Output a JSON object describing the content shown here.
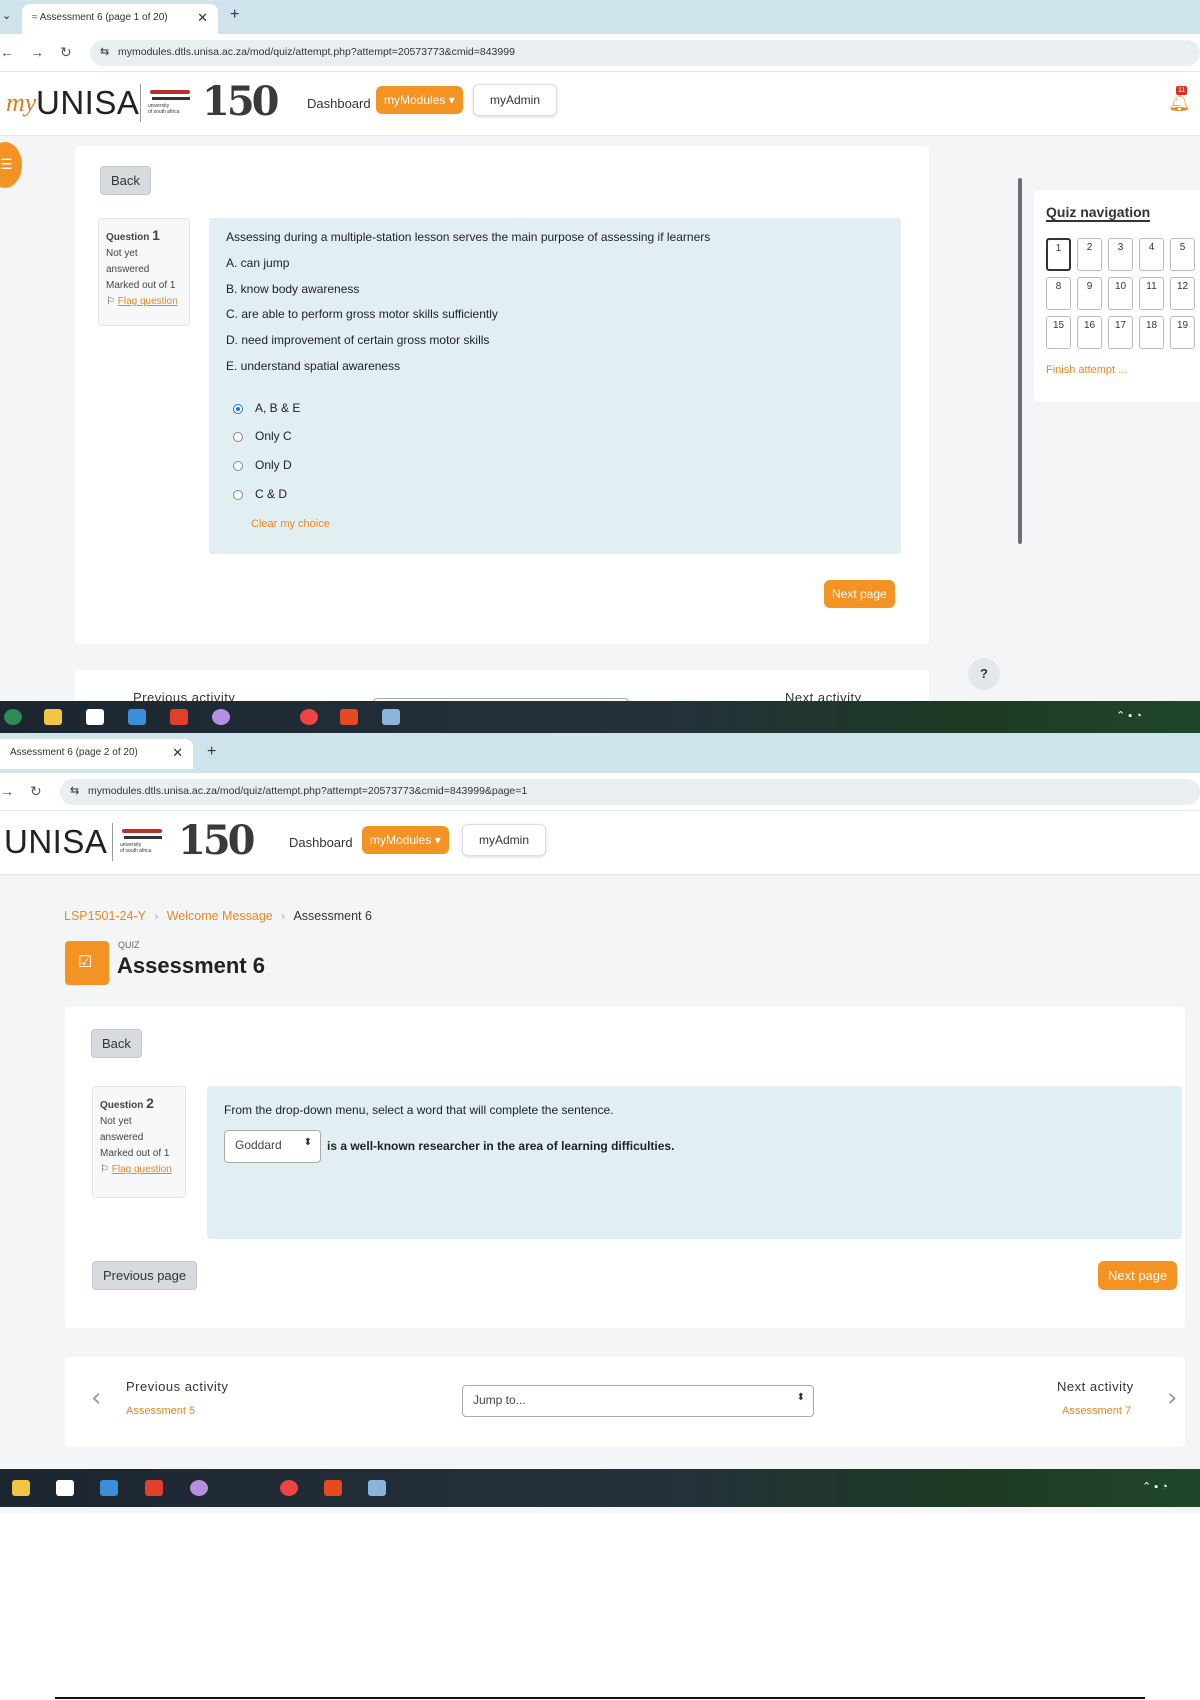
{
  "shot1": {
    "tab_title": "Assessment 6 (page 1 of 20)",
    "url": "mymodules.dtls.unisa.ac.za/mod/quiz/attempt.php?attempt=20573773&cmid=843999",
    "nav": {
      "dashboard": "Dashboard",
      "mymodules": "myModules ▾",
      "myadmin": "myAdmin"
    },
    "notif_count": "11",
    "back_label": "Back",
    "question": {
      "label": "Question",
      "number": "1",
      "status": "Not yet answered",
      "marked": "Marked out of 1",
      "flag": "Flag question",
      "stem": "Assessing during a multiple-station lesson serves the main purpose of assessing if learners",
      "statements": [
        "A. can jump",
        "B. know body awareness",
        "C. are able to perform gross motor skills sufficiently",
        "D. need improvement of certain gross motor skills",
        "E. understand spatial awareness"
      ],
      "options": [
        {
          "label": "A, B & E",
          "selected": true
        },
        {
          "label": "Only C",
          "selected": false
        },
        {
          "label": "Only D",
          "selected": false
        },
        {
          "label": "C & D",
          "selected": false
        }
      ],
      "clear": "Clear my choice"
    },
    "next_page": "Next page",
    "help": "?",
    "prev_activity": "Previous activity",
    "next_activity": "Next activity",
    "quiz_nav": {
      "title": "Quiz navigation",
      "cells": [
        "1",
        "2",
        "3",
        "4",
        "5",
        "8",
        "9",
        "10",
        "11",
        "12",
        "15",
        "16",
        "17",
        "18",
        "19"
      ],
      "finish": "Finish attempt ..."
    }
  },
  "shot2": {
    "tab_title": "Assessment 6 (page 2 of 20)",
    "url": "mymodules.dtls.unisa.ac.za/mod/quiz/attempt.php?attempt=20573773&cmid=843999&page=1",
    "nav": {
      "dashboard": "Dashboard",
      "mymodules": "myModules ▾",
      "myadmin": "myAdmin"
    },
    "breadcrumb": [
      "LSP1501-24-Y",
      "Welcome Message",
      "Assessment 6"
    ],
    "activity_type": "QUIZ",
    "page_title": "Assessment 6",
    "back_label": "Back",
    "question": {
      "label": "Question",
      "number": "2",
      "status": "Not yet answered",
      "marked": "Marked out of 1",
      "flag": "Flag question",
      "instruction": "From the drop-down menu, select a word that will complete the sentence.",
      "selected_word": "Goddard",
      "sentence_rest": "is a well-known researcher in the area of learning difficulties."
    },
    "previous_page": "Previous page",
    "next_page": "Next page",
    "prev_activity": "Previous activity",
    "prev_activity_link": "Assessment 5",
    "jump_to": "Jump to...",
    "next_activity": "Next activity",
    "next_activity_link": "Assessment 7"
  },
  "colors": {
    "accent": "#f39324",
    "question_bg": "#e1eff2",
    "tabbar": "#cfe3ec",
    "radio_selected": "#1a73e8"
  }
}
